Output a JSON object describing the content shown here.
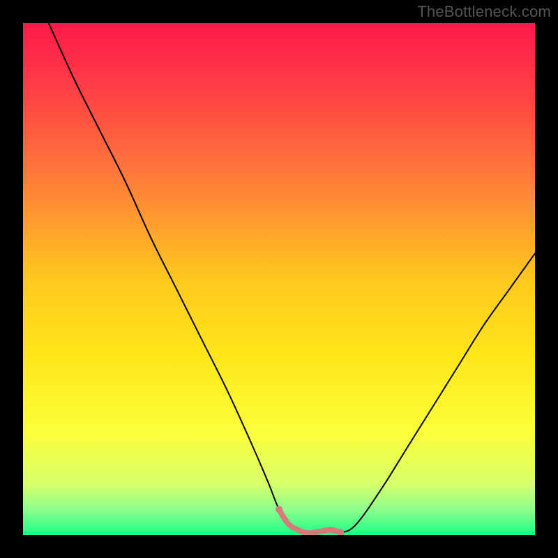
{
  "watermark": "TheBottleneck.com",
  "chart_data": {
    "type": "line",
    "title": "",
    "xlabel": "",
    "ylabel": "",
    "xlim": [
      0,
      100
    ],
    "ylim": [
      0,
      100
    ],
    "background_gradient": {
      "stops": [
        {
          "offset": 0.0,
          "color": "#ff1a4b"
        },
        {
          "offset": 0.1,
          "color": "#ff3547"
        },
        {
          "offset": 0.3,
          "color": "#ff7a3a"
        },
        {
          "offset": 0.5,
          "color": "#ffc81e"
        },
        {
          "offset": 0.65,
          "color": "#ffe61a"
        },
        {
          "offset": 0.8,
          "color": "#fbff3a"
        },
        {
          "offset": 0.9,
          "color": "#d7ff6a"
        },
        {
          "offset": 0.95,
          "color": "#8dff8d"
        },
        {
          "offset": 1.0,
          "color": "#1aff86"
        }
      ]
    },
    "series": [
      {
        "name": "bottleneck-curve",
        "stroke": "#000000",
        "stroke_width": 2,
        "x": [
          5,
          10,
          15,
          20,
          25,
          30,
          35,
          40,
          45,
          48,
          50,
          52,
          55,
          57,
          60,
          62,
          65,
          70,
          75,
          80,
          85,
          90,
          95,
          100
        ],
        "values": [
          100,
          89,
          79,
          69,
          58,
          48,
          38,
          28,
          17,
          10,
          5,
          2,
          0.5,
          0.5,
          1,
          0.5,
          2,
          9,
          17,
          25,
          33,
          41,
          48,
          55
        ]
      },
      {
        "name": "valley-highlight",
        "stroke": "#d67a7a",
        "stroke_width": 8,
        "x": [
          50,
          52,
          55,
          57,
          60,
          62
        ],
        "values": [
          5,
          2,
          0.5,
          0.5,
          1,
          0.5
        ]
      }
    ],
    "highlight_endpoints": {
      "color": "#d67a7a",
      "radius": 5,
      "points": [
        {
          "x": 50,
          "y": 5
        },
        {
          "x": 62,
          "y": 0.5
        }
      ]
    }
  }
}
